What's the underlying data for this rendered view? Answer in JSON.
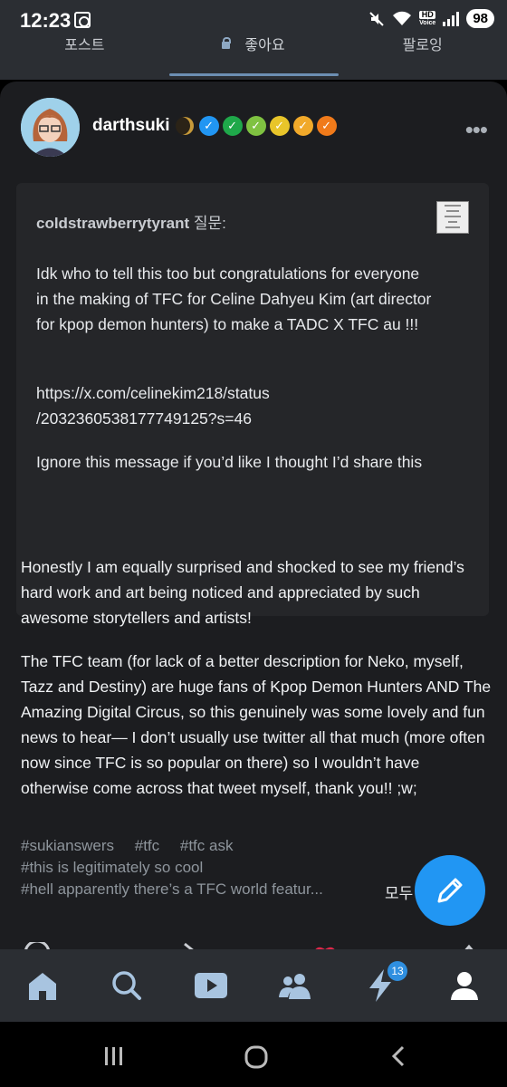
{
  "status_bar": {
    "time": "12:23",
    "hd_label": "HD",
    "voice_label": "Voice",
    "battery": "98"
  },
  "top_tabs": [
    {
      "label": "포스트"
    },
    {
      "label": "좋아요"
    },
    {
      "label": "팔로잉"
    }
  ],
  "post": {
    "author": "darthsuki",
    "badge_colors": [
      "#2196f3",
      "#1fa84a",
      "#7fc241",
      "#e8c52a",
      "#f1a92a",
      "#f07a1a"
    ],
    "ask": {
      "asker": "coldstrawberrytyrant",
      "asker_suffix": "질문:",
      "paragraphs": [
        "Idk who to tell this too but congratulations for everyone in the making of TFC for Celine Dahyeu Kim (art director for kpop demon hunters) to make a TADC X TFC au !!!",
        "https://x.com/celinekim218/status /2032360538177749125?s=46",
        "Ignore this message if you’d like I thought I’d share this"
      ]
    },
    "answer": [
      "Honestly I am equally surprised and shocked to see my friend’s hard work and art being noticed and appreciated by such awesome storytellers and artists!",
      "The TFC team (for lack of a better description for Neko, myself, Tazz and Destiny) are huge fans of Kpop Demon Hunters AND The Amazing Digital Circus, so this genuinely was some lovely and fun news to hear— I don’t usually use twitter all that much (more often now since TFC is so popular on there) so I wouldn’t have otherwise come across that tweet myself, thank you!! ;w;"
    ],
    "tags": {
      "line1": [
        "#sukianswers",
        "#tfc",
        "#tfc ask"
      ],
      "line2": "#this is legitimately so cool",
      "line3": "#hell apparently there’s a TFC world featur..."
    },
    "more_label": "모두"
  },
  "bottom_nav": {
    "items": [
      "home-icon",
      "search-icon",
      "video-icon",
      "community-icon",
      "activity-icon",
      "account-icon"
    ],
    "activity_badge": "13"
  },
  "colors": {
    "accent": "#2196f3",
    "card_bg": "#1c1d20",
    "ask_bg": "#252629",
    "nav_bg": "#2b2e33"
  }
}
